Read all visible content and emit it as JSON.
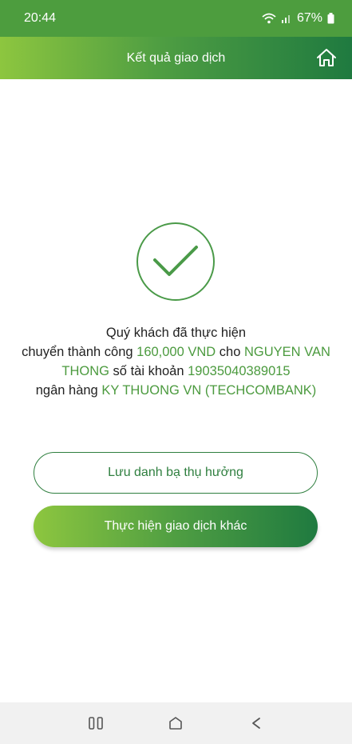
{
  "status_bar": {
    "time": "20:44",
    "battery": "67%",
    "icons": [
      "wifi-icon",
      "signal-icon",
      "battery-icon"
    ]
  },
  "header": {
    "title": "Kết quả giao dịch",
    "home_icon": "home-icon"
  },
  "result": {
    "icon": "check-icon",
    "line1": "Quý khách đã thực hiện",
    "part_a": "chuyển thành công ",
    "amount": "160,000 VND",
    "part_b": " cho ",
    "recipient": "NGUYEN VAN THONG",
    "part_c": " số tài khoản ",
    "account": "19035040389015",
    "part_d": "ngân hàng ",
    "bank": "KY THUONG VN (TECHCOMBANK)"
  },
  "buttons": {
    "save_contact": "Lưu danh bạ thụ hưởng",
    "new_transaction": "Thực hiện giao dịch khác"
  },
  "nav": {
    "icons": [
      "recent-apps-icon",
      "home-nav-icon",
      "back-icon"
    ]
  },
  "colors": {
    "accent": "#4b9a3e",
    "gradient_start": "#8dc63f",
    "gradient_end": "#1f7a40"
  }
}
